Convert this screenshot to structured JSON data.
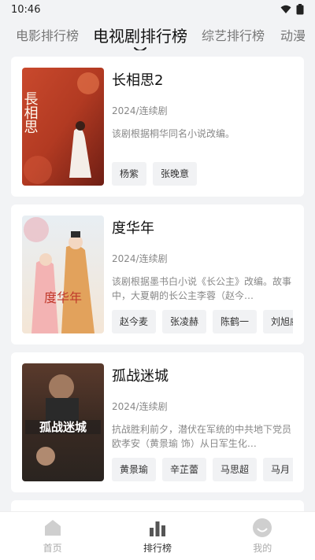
{
  "status": {
    "time": "10:46"
  },
  "tabs": [
    {
      "label": "电影排行榜"
    },
    {
      "label": "电视剧排行榜"
    },
    {
      "label": "综艺排行榜"
    },
    {
      "label": "动漫"
    }
  ],
  "shows": [
    {
      "title": "长相思2",
      "meta": "2024/连续剧",
      "desc": "该剧根据桐华同名小说改编。",
      "actors": [
        "杨紫",
        "张晚意"
      ]
    },
    {
      "title": "度华年",
      "meta": "2024/连续剧",
      "desc": "该剧根据墨书白小说《长公主》改编。故事中，大夏朝的长公主李蓉（赵今…",
      "actors": [
        "赵今麦",
        "张凌赫",
        "陈鹤一",
        "刘旭威"
      ]
    },
    {
      "title": "孤战迷城",
      "meta": "2024/连续剧",
      "desc": "抗战胜利前夕，潜伏在军统的中共地下党员欧孝安（黄景瑜 饰）从日军生化…",
      "actors": [
        "黄景瑜",
        "辛芷蕾",
        "马思超",
        "马月"
      ]
    }
  ],
  "posters": [
    {
      "caption": "長相思"
    },
    {
      "caption": "度华年"
    },
    {
      "caption": "孤战迷城"
    }
  ],
  "nav": [
    {
      "label": "首页"
    },
    {
      "label": "排行榜"
    },
    {
      "label": "我的"
    }
  ],
  "colors": {
    "accent": "#222222",
    "muted": "#888888",
    "bg": "#f2f3f5"
  }
}
